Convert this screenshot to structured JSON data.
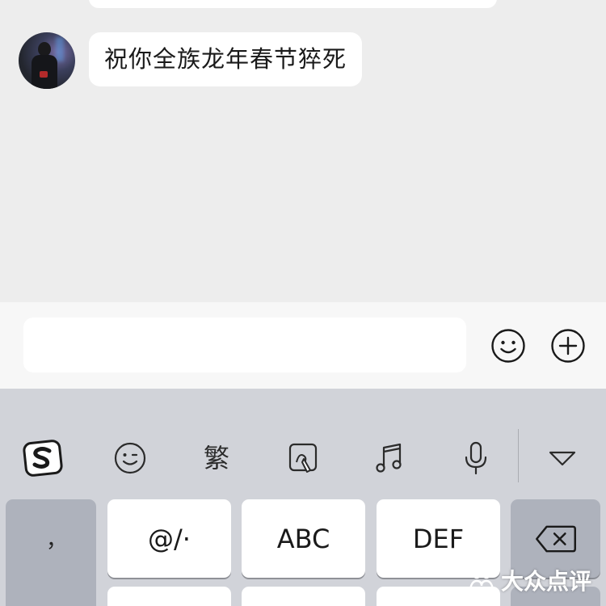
{
  "chat": {
    "message": "祝你全族龙年春节猝死"
  },
  "input_bar": {
    "value": ""
  },
  "keyboard": {
    "toolbar": {
      "sogou_logo": "sogou-logo",
      "emoji": "smiley-icon",
      "traditional_label": "繁",
      "handwriting": "handwriting-icon",
      "music": "music-note-icon",
      "voice": "microphone-icon",
      "collapse": "triangle-down-icon"
    },
    "keys": {
      "punct_top": "，",
      "punct_bottom": "。",
      "key1": "@/·",
      "key2": "ABC",
      "key3": "DEF",
      "delete": "delete-icon"
    }
  },
  "watermark": {
    "text": "大众点评"
  }
}
